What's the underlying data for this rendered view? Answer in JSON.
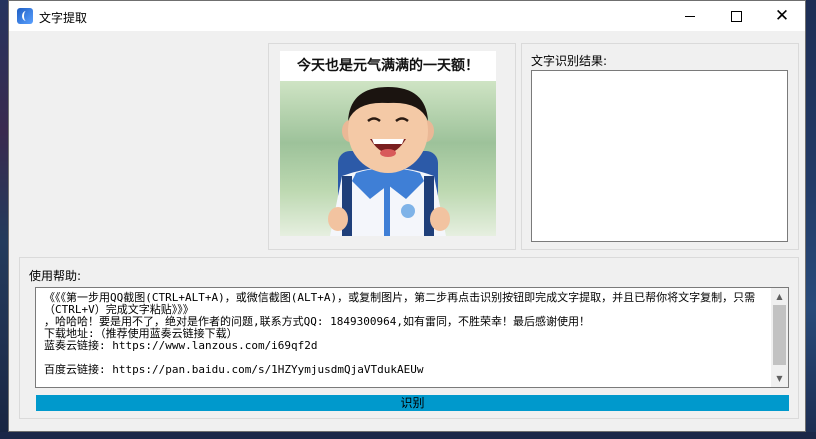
{
  "window": {
    "title": "文字提取"
  },
  "image_panel": {
    "caption": "今天也是元气满满的一天额！"
  },
  "result": {
    "label": "文字识别结果:",
    "text": ""
  },
  "help": {
    "label": "使用帮助:",
    "text": "《《《第一步用QQ截图(CTRL+ALT+A)，或微信截图(ALT+A)，或复制图片，第二步再点击识别按钮即完成文字提取，并且已帮你将文字复制，只需（CTRL+V）完成文字粘贴》》》\n，哈哈哈！要是用不了，绝对是作者的问题,联系方式QQ: 1849300964,如有雷同，不胜荣幸！最后感谢使用！\n下载地址:（推荐使用蓝奏云链接下载）\n蓝奏云链接: https://www.lanzous.com/i69qf2d\n\n百度云链接: https://pan.baidu.com/s/1HZYymjusdmQjaVTdukAEUw"
  },
  "ocr_button": {
    "label": "识别"
  },
  "colors": {
    "button_bg": "#0099cc",
    "window_bg": "#f0f0f0"
  }
}
